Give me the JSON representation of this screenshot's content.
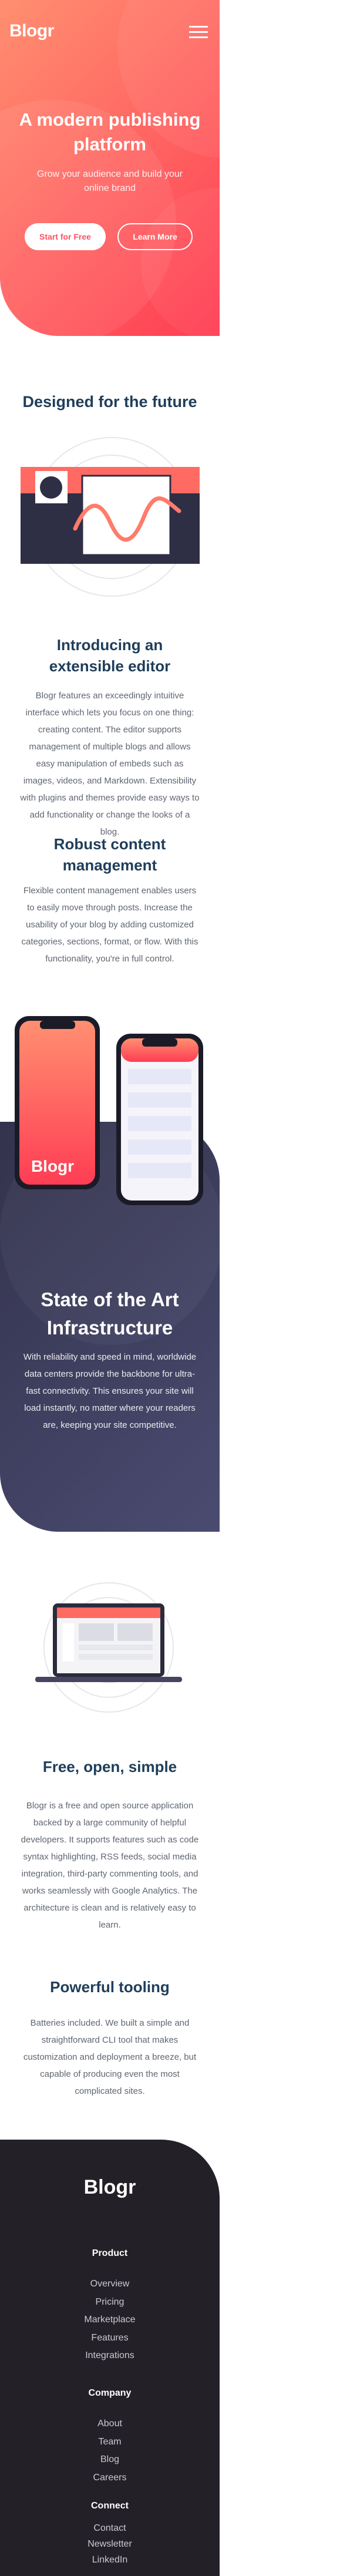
{
  "header": {
    "logo": "Blogr",
    "menu_icon": "hamburger-icon"
  },
  "hero": {
    "title": "A modern publishing platform",
    "subtitle": "Grow your audience and build your online brand",
    "primary_button": "Start for Free",
    "secondary_button": "Learn More"
  },
  "future": {
    "heading": "Designed for the future",
    "editor_title": "Introducing an extensible editor",
    "editor_text": "Blogr features an exceedingly intuitive interface which lets you focus on one thing: creating content. The editor supports management of multiple blogs and allows easy manipulation of embeds such as images, videos, and Markdown. Extensibility with plugins and themes provide easy ways to add functionality or change the looks of a blog.",
    "robust_title": "Robust content management",
    "robust_text": "Flexible content management enables users to easily move through posts. Increase the usability of your blog by adding customized categories, sections, format, or flow. With this functionality, you're in full control."
  },
  "infra": {
    "phone_logo": "Blogr",
    "title": "State of the Art Infrastructure",
    "text": "With reliability and speed in mind, worldwide data centers provide the backbone for ultra-fast connectivity. This ensures your site will load instantly, no matter where your readers are, keeping your site competitive."
  },
  "features": {
    "free_title": "Free, open, simple",
    "free_text": "Blogr is a free and open source application backed by a large community of helpful developers. It supports features such as code syntax highlighting, RSS feeds, social media integration, third-party commenting tools, and works seamlessly with Google Analytics. The architecture is clean and is relatively easy to learn.",
    "tooling_title": "Powerful tooling",
    "tooling_text": "Batteries included. We built a simple and straightforward CLI tool that makes customization and deployment a breeze, but capable of producing even the most complicated sites."
  },
  "footer": {
    "logo": "Blogr",
    "product": {
      "heading": "Product",
      "links": [
        "Overview",
        "Pricing",
        "Marketplace",
        "Features",
        "Integrations"
      ]
    },
    "company": {
      "heading": "Company",
      "links": [
        "About",
        "Team",
        "Blog",
        "Careers"
      ]
    },
    "connect": {
      "heading": "Connect",
      "links": [
        "Contact",
        "Newsletter",
        "LinkedIn"
      ]
    }
  },
  "colors": {
    "hero_start": "#ff8f70",
    "hero_end": "#ff3d54",
    "heading": "#1f3e5a",
    "dark_section": "#33334d",
    "footer": "#232127"
  }
}
